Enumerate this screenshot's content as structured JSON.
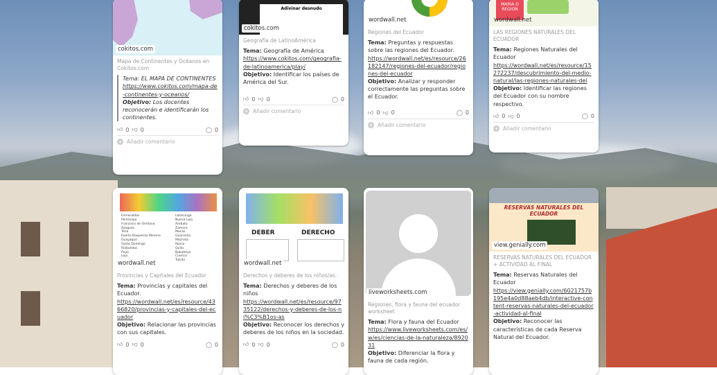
{
  "cards": [
    {
      "source": "cokitos.com",
      "caption": "Mapa de Continentes y Océanos en Cokitos.com",
      "tema_label": "Tema:",
      "tema": "EL MAPA DE CONTINENTES",
      "link": "https://www.cokitos.com/mapa-de-continentes-y-oceanos/",
      "objetivo_label": "Objetivo:",
      "objetivo": "Los docentes reconocerán e identificarán los continentes.",
      "likes": "0",
      "dislikes": "0",
      "comments": "0",
      "add_comment": "Añadir comentario"
    },
    {
      "source": "cokitos.com",
      "thumb_text": "Adivinar desnudo",
      "caption": "Geografía de LatinoAmérica",
      "tema_label": "Tema:",
      "tema": "Geografía de América",
      "link": "https://www.cokitos.com/geografia-de-latinoamerica/play/",
      "objetivo_label": "Objetivo:",
      "objetivo": "Identificar los países de América del Sur.",
      "likes": "0",
      "dislikes": "0",
      "comments": "0",
      "add_comment": "Añadir comentario"
    },
    {
      "source": "wordwall.net",
      "caption": "Regiones del Ecuador",
      "tema_label": "Tema:",
      "tema": "Preguntas y respuestas sobre las regiones del Ecuador.",
      "link": "https://wordwall.net/es/resource/26182147/regiones-del-ecuador/regiones-del-ecuador",
      "objetivo_label": "Objetivo:",
      "objetivo": "Analizar y responder correctamente las preguntas sobre el Ecuador.",
      "likes": "0",
      "dislikes": "0",
      "comments": "0",
      "add_comment": "Añadir comentario"
    },
    {
      "source": "wordwall.net",
      "thumb_text": "MARIA D REGION",
      "caption": "LAS REGIONES NATURALES DEL ECUADOR",
      "tema_label": "Tema:",
      "tema": "Regiones Naturales del Ecuador",
      "link": "https://wordwall.net/es/resource/15272237/descubrimiento-del-medio-natural/las-regiones-naturales-del",
      "objetivo_label": "Objetivo:",
      "objetivo": "Identificar las regiones del Ecuador con su nombre respectivo.",
      "likes": "0",
      "dislikes": "0",
      "comments": "0",
      "add_comment": "Añadir comentario"
    },
    {
      "source": "wordwall.net",
      "caption": "Provincias y Capitales del Ecuador",
      "tema_label": "Tema:",
      "tema": "Provincias y capitales del Ecuador.",
      "link": "https://wordwall.net/es/resource/4366820/provincias-y-capitales-del-ecuador",
      "objetivo_label": "Objetivo:",
      "objetivo": "Relacionar las provincias con sus capitales.",
      "likes": "0",
      "dislikes": "0",
      "comments": "0",
      "thumb_list_left": [
        "Esmeraldas",
        "Portoviejo",
        "Francisco de Orellana",
        "Azogues",
        "Tena",
        "Puerto Baquerizo Moreno",
        "Guayaquil",
        "Santo Domingo",
        "Riobamba",
        "Puyo",
        "Loja"
      ],
      "thumb_list_right": [
        "Latacunga",
        "Nueva Loja",
        "Ambato",
        "Zamora",
        "Macas",
        "Guaranda",
        "Machala",
        "Ibarra",
        "Quito",
        "Babahoyo",
        "Cuenca",
        "Tulcán"
      ]
    },
    {
      "source": "wordwall.net",
      "thumb_col1": "DEBER",
      "thumb_col2": "DERECHO",
      "caption": "Derechos y deberes de los niños/as.",
      "tema_label": "Tema:",
      "tema": "Derechos y deberes de los niños",
      "link": "https://wordwall.net/es/resource/9735122/derechos-y-deberes-de-los-ni%C3%B1os-as",
      "objetivo_label": "Objetivo:",
      "objetivo": "Reconocer los derechos y deberes de los niños en la sociedad.",
      "likes": "0",
      "dislikes": "0",
      "comments": "0"
    },
    {
      "source": "liveworksheets.com",
      "caption": "Regiones, flora y fauna del ecuador worksheet",
      "tema_label": "Tema:",
      "tema": "Flora y fauna del Ecuador",
      "link": "https://www.liveworksheets.com/es/w/es/ciencias-de-la-naturaleza/892031",
      "objetivo_label": "Objetivo:",
      "objetivo": "Diferenciar la flora y fauna de cada región."
    },
    {
      "source": "view.genially.com",
      "thumb_title": "RESERVAS NATURALES DEL ECUADOR",
      "caption": "RESERVAS NATURALES DEL ECUADOR + ACTIVIDAD AL FINAL",
      "tema_label": "Tema:",
      "tema": "Reservas Naturales del Ecuador",
      "link": "https://view.genially.com/6021757b195e4a0d88aeb4db/interactive-content-reservas-naturales-del-ecuador-actividad-al-final",
      "objetivo_label": "Objetivo:",
      "objetivo": "Reconocer las características de cada Reserva Natural del Ecuador."
    }
  ],
  "colors": {
    "accent": "#c7523a",
    "card": "#ffffff",
    "muted": "#9a9a9a"
  }
}
